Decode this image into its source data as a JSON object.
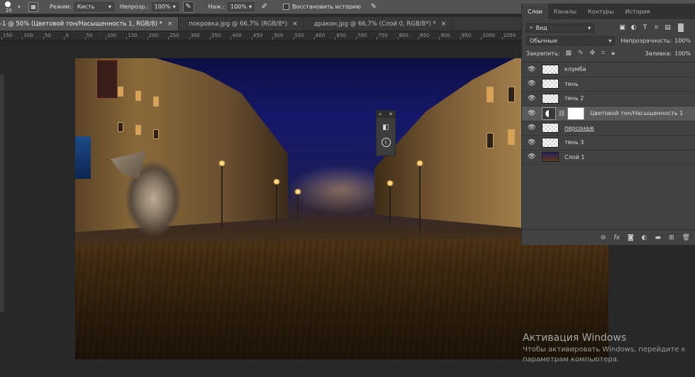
{
  "options_bar": {
    "brush_size": "20",
    "mode_label": "Режим:",
    "mode_value": "Кисть",
    "opacity_label": "Непрозр.:",
    "opacity_value": "100%",
    "pressure_label": "Наж.:",
    "pressure_value": "100%",
    "restore_history_label": "Восстановить историю"
  },
  "tabs": [
    {
      "label": "-1 @ 50% (Цветовой тон/Насыщенность 1, RGB/8) *",
      "close": "×",
      "active": true
    },
    {
      "label": "покровка.jpg @ 66,7% (RGB/8*)",
      "close": "×",
      "active": false
    },
    {
      "label": "дракон.jpg @ 66,7% (Слой 0, RGB/8*) *",
      "close": "×",
      "active": false
    }
  ],
  "ruler": {
    "labels": [
      "150",
      "100",
      "50",
      "0",
      "50",
      "100",
      "150",
      "200",
      "250",
      "300",
      "350",
      "400",
      "450",
      "500",
      "550",
      "600",
      "650",
      "700",
      "750",
      "800",
      "850",
      "900",
      "950",
      "1000",
      "1050"
    ]
  },
  "layers_panel": {
    "tabs": [
      "Слои",
      "Каналы",
      "Контуры",
      "История"
    ],
    "filter_label": "Вид",
    "blend_mode": "Обычные",
    "opacity_label": "Непрозрачность:",
    "opacity_value": "100%",
    "lock_label": "Закрепить:",
    "fill_label": "Заливка:",
    "fill_value": "100%",
    "layers": [
      {
        "name": "клумба",
        "type": "transparent"
      },
      {
        "name": "тень",
        "type": "transparent"
      },
      {
        "name": "тень 2",
        "type": "transparent"
      },
      {
        "name": "Цветовой тон/Насыщенность 1",
        "type": "adjustment",
        "selected": true
      },
      {
        "name": "персонаж",
        "type": "transparent",
        "underline": true
      },
      {
        "name": "тень 3",
        "type": "transparent"
      },
      {
        "name": "Слой 1",
        "type": "photo"
      }
    ]
  },
  "watermark": {
    "title": "Активация Windows",
    "line1": "Чтобы активировать Windows, перейдите к",
    "line2": "параметрам компьютера."
  },
  "icons": {
    "brush": "brush-icon",
    "airbrush": "airbrush-icon",
    "pressure": "pressure-icon",
    "history_brush": "history-brush-icon",
    "eye": "eye-icon",
    "info": "info-icon"
  }
}
